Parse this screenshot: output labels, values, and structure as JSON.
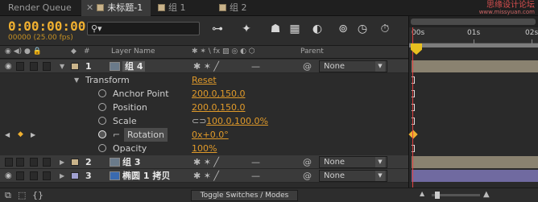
{
  "tabs": [
    {
      "label": "Render Queue",
      "active": false
    },
    {
      "label": "未标题-1",
      "active": true
    },
    {
      "label": "组 1",
      "active": false
    },
    {
      "label": "组 2",
      "active": false
    }
  ],
  "watermark": {
    "title": "思缘设计论坛",
    "url": "www.missyuan.com"
  },
  "timecode": "0:00:00:00",
  "fps": "00000 (25.00 fps)",
  "search": {
    "placeholder": ""
  },
  "columns": {
    "layer_name": "Layer Name",
    "parent": "Parent",
    "hash": "#"
  },
  "timeline": {
    "labels": [
      "00s",
      "01s",
      "02s"
    ]
  },
  "layers": [
    {
      "num": "1",
      "name": "组 4",
      "label_color": "#c9b38a",
      "parent": "None",
      "selected": true,
      "bar_color": "#8a8270"
    },
    {
      "num": "2",
      "name": "组 3",
      "label_color": "#c9b38a",
      "parent": "None",
      "selected": false,
      "bar_color": "#8a8270"
    },
    {
      "num": "3",
      "name": "椭圆 1 拷贝",
      "label_color": "#a0a0d0",
      "parent": "None",
      "selected": false,
      "bar_color": "#706aa0"
    }
  ],
  "transform": {
    "group_label": "Transform",
    "reset_label": "Reset",
    "properties": [
      {
        "name": "Anchor Point",
        "value": "200.0,150.0"
      },
      {
        "name": "Position",
        "value": "200.0,150.0"
      },
      {
        "name": "Scale",
        "value": "100.0,100.0%"
      },
      {
        "name": "Rotation",
        "value": "0x+0.0°"
      },
      {
        "name": "Opacity",
        "value": "100%"
      }
    ]
  },
  "footer": {
    "toggle_label": "Toggle Switches / Modes"
  }
}
